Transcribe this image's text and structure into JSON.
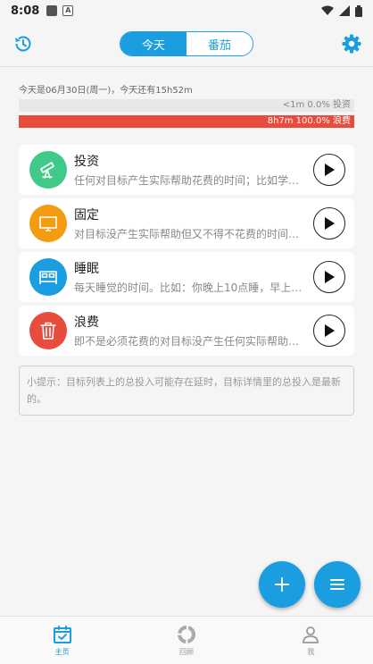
{
  "status": {
    "time": "8:08",
    "notif_letter": "A"
  },
  "header": {
    "tabs": [
      {
        "label": "今天",
        "active": true
      },
      {
        "label": "番茄",
        "active": false
      }
    ]
  },
  "summary": {
    "info": "今天是06月30日(周一)，今天还有15h52m",
    "invest": {
      "label": "<1m 0.0% 投资",
      "fraction": 0.0
    },
    "waste": {
      "label": "8h7m 100.0% 浪费",
      "fraction": 1.0
    }
  },
  "goals": [
    {
      "name": "投资",
      "desc": "任何对目标产生实际帮助花费的时间；比如学习、锻炼…",
      "color": "#3fca8a",
      "icon": "telescope-icon"
    },
    {
      "name": "固定",
      "desc": "对目标没产生实际帮助但又不得不花费的时间；比如吃饭…",
      "color": "#f39c12",
      "icon": "monitor-icon"
    },
    {
      "name": "睡眠",
      "desc": "每天睡觉的时间。比如：你晚上10点睡，早上6点起…",
      "color": "#1a9ee0",
      "icon": "bed-icon"
    },
    {
      "name": "浪费",
      "desc": "即不是必须花费的对目标没产生任何实际帮助的时间…",
      "color": "#e74c3c",
      "icon": "trash-icon"
    }
  ],
  "tip": "小提示：目标列表上的总投入可能存在延时，目标详情里的总投入是最新的。",
  "nav": [
    {
      "label": "主页",
      "icon": "calendar-check-icon",
      "active": true
    },
    {
      "label": "回顾",
      "icon": "ring-chart-icon",
      "active": false
    },
    {
      "label": "我",
      "icon": "person-icon",
      "active": false
    }
  ],
  "colors": {
    "accent": "#1a9ee0",
    "waste": "#e74c3c"
  }
}
